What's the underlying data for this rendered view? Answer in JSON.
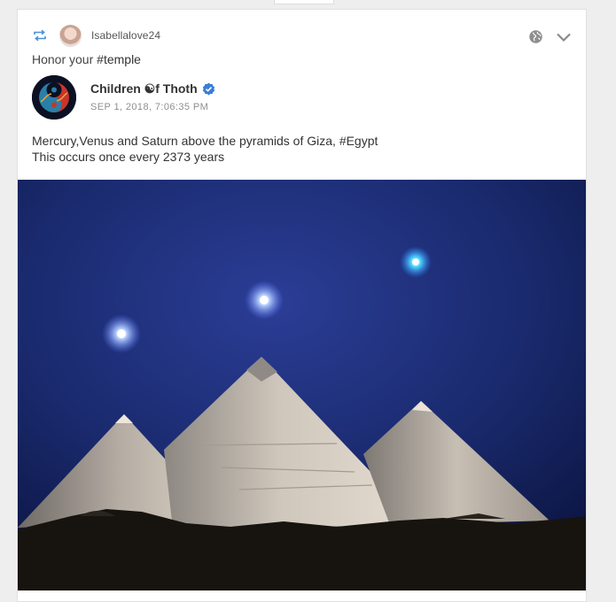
{
  "share": {
    "icon": "repost-icon",
    "username": "Isabellalove24",
    "comment_text": "Honor your ",
    "comment_hashtag": "#temple"
  },
  "post": {
    "author_name": "Children ☯︎f Thoth",
    "timestamp": "SEP 1, 2018, 7:06:35 PM",
    "text_part1": "Mercury,Venus and Saturn above the pyramids of Giza, ",
    "text_hashtag": "#Egypt",
    "text_line2": "This occurs once every 2373 years",
    "image_icon": "pyramids-night-photo"
  },
  "header_icons": [
    "globe-icon",
    "chevron-down-icon"
  ],
  "colors": {
    "accent": "#4a90d9",
    "verified": "#3b7dd8",
    "sky_dark": "#0e1a4a",
    "sky_light": "#2a3f9a"
  }
}
